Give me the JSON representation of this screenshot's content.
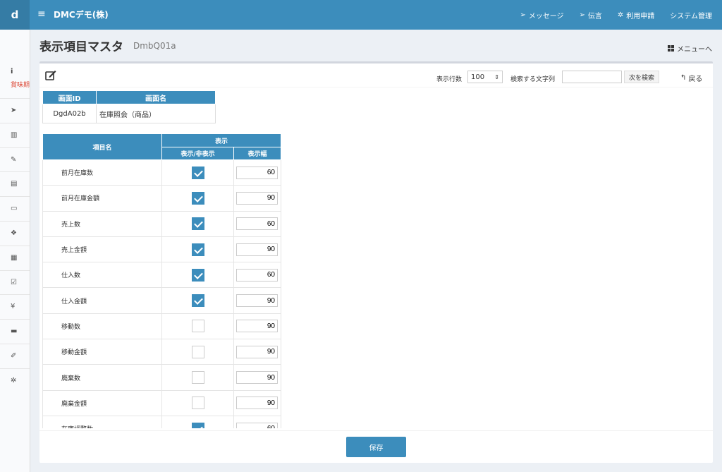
{
  "header": {
    "logo": "d",
    "title": "DMCデモ(株)",
    "nav": [
      {
        "icon": "paper-plane-icon",
        "label": "メッセージ"
      },
      {
        "icon": "paper-plane-icon",
        "label": "伝言"
      },
      {
        "icon": "gear-icon",
        "label": "利用申請"
      },
      {
        "icon": "",
        "label": "システム管理"
      }
    ]
  },
  "sidebar": {
    "info_icon": "i",
    "info_text": "賞味期",
    "items": [
      {
        "icon": "send-icon",
        "glyph": "➤"
      },
      {
        "icon": "bar-chart-icon",
        "glyph": "▥"
      },
      {
        "icon": "edit-icon",
        "glyph": "✎"
      },
      {
        "icon": "archive-icon",
        "glyph": "▤"
      },
      {
        "icon": "document-icon",
        "glyph": "▭"
      },
      {
        "icon": "cubes-icon",
        "glyph": "❖"
      },
      {
        "icon": "calendar-icon",
        "glyph": "▦"
      },
      {
        "icon": "calendar-check-icon",
        "glyph": "☑"
      },
      {
        "icon": "yen-icon",
        "glyph": "¥"
      },
      {
        "icon": "briefcase-icon",
        "glyph": "▬"
      },
      {
        "icon": "wrench-icon",
        "glyph": "✐"
      },
      {
        "icon": "gears-icon",
        "glyph": "✲"
      }
    ]
  },
  "page": {
    "title": "表示項目マスタ",
    "code": "DmbQ01a",
    "menu_link": "メニューへ"
  },
  "toolbar": {
    "rows_label": "表示行数",
    "rows_value": "100",
    "search_label": "検索する文字列",
    "search_value": "",
    "next_button": "次を検索",
    "back_link": "戻る"
  },
  "screen_table": {
    "headers": [
      "画面ID",
      "画面名"
    ],
    "row": [
      "DgdA02b",
      "在庫照会（商品）"
    ]
  },
  "items_table": {
    "header_name": "項目名",
    "header_display": "表示",
    "header_visible": "表示/非表示",
    "header_width": "表示幅",
    "rows": [
      {
        "name": "前月在庫数",
        "visible": true,
        "width": "60"
      },
      {
        "name": "前月在庫金額",
        "visible": true,
        "width": "90"
      },
      {
        "name": "売上数",
        "visible": true,
        "width": "60"
      },
      {
        "name": "売上金額",
        "visible": true,
        "width": "90"
      },
      {
        "name": "仕入数",
        "visible": true,
        "width": "60"
      },
      {
        "name": "仕入金額",
        "visible": true,
        "width": "90"
      },
      {
        "name": "移動数",
        "visible": false,
        "width": "90"
      },
      {
        "name": "移動金額",
        "visible": false,
        "width": "90"
      },
      {
        "name": "廃棄数",
        "visible": false,
        "width": "90"
      },
      {
        "name": "廃棄金額",
        "visible": false,
        "width": "90"
      },
      {
        "name": "在庫調整数",
        "visible": true,
        "width": "60"
      }
    ]
  },
  "footer": {
    "save_button": "保存"
  }
}
